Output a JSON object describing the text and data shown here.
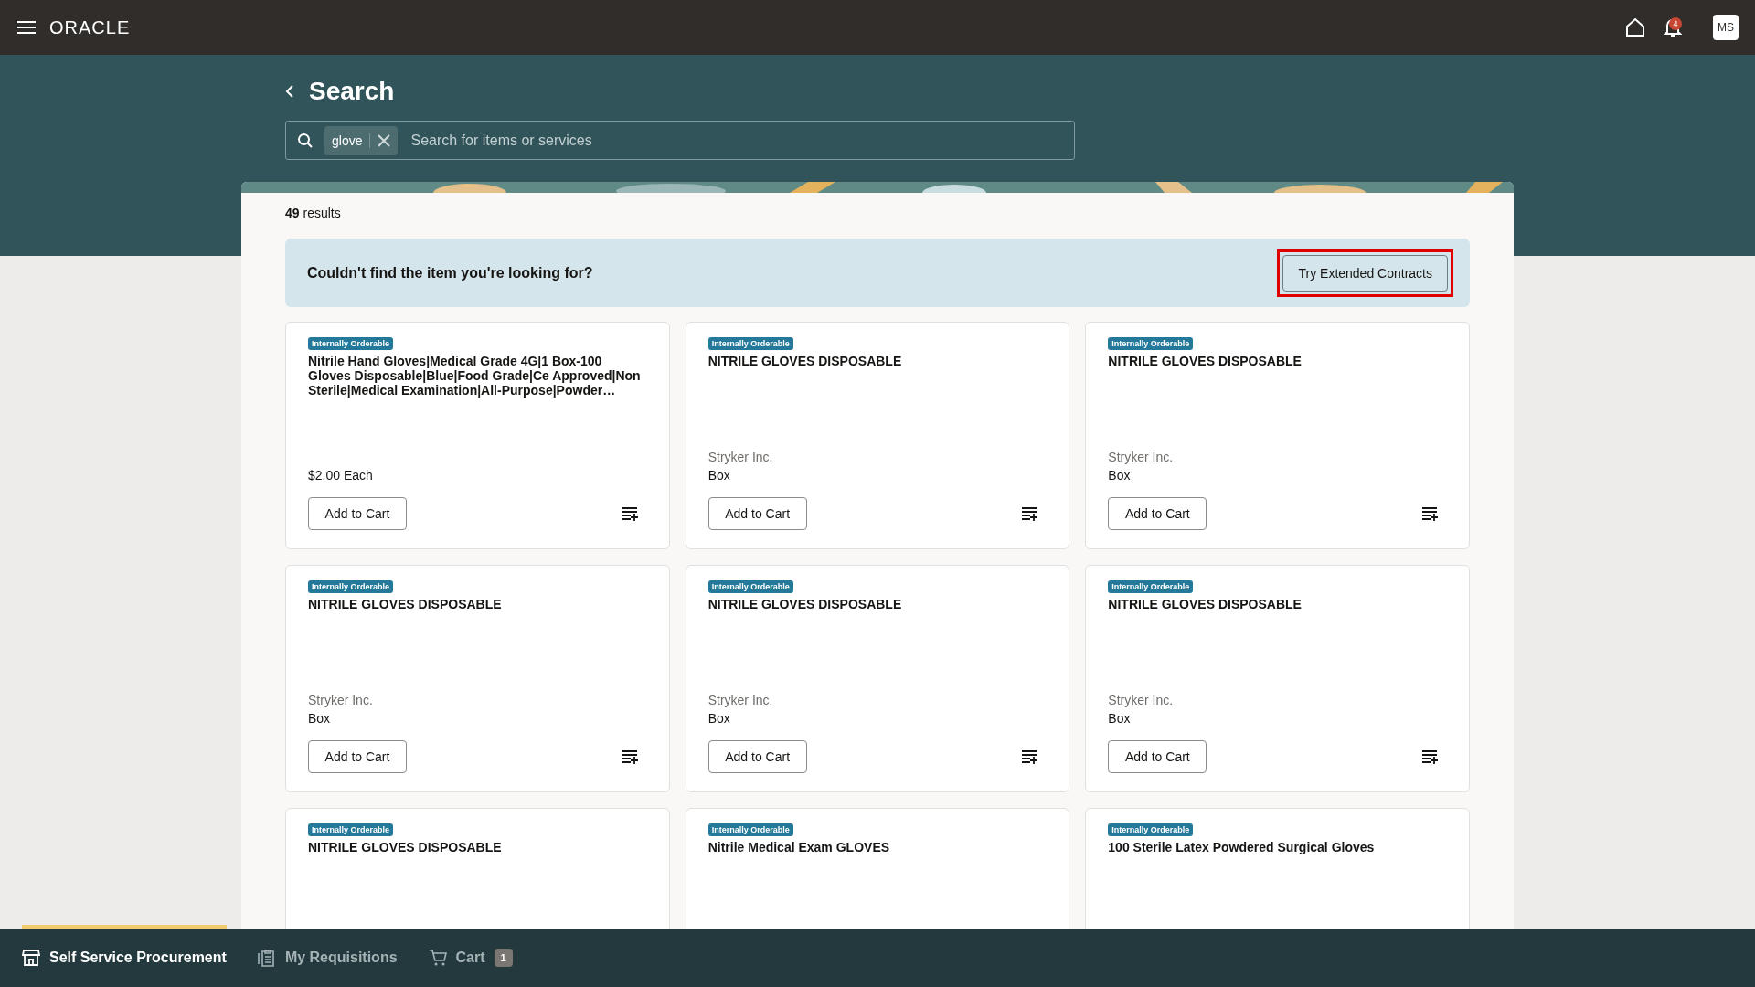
{
  "header": {
    "logo": "ORACLE",
    "notifications": "4",
    "avatar": "MS"
  },
  "page": {
    "title": "Search",
    "search": {
      "chip": "glove",
      "placeholder": "Search for items or services"
    }
  },
  "results": {
    "count": "49",
    "label": "results"
  },
  "banner": {
    "text": "Couldn't find the item you're looking for?",
    "button": {
      "label": "Try Extended Contracts",
      "highlighted": true
    }
  },
  "cards": [
    {
      "badge": "Internally Orderable",
      "title": "Nitrile Hand Gloves|Medical Grade 4G|1 Box-100 Gloves Disposable|Blue|Food Grade|Ce Approved|Non Sterile|Medical Examination|All-Purpose|Powder…",
      "price": "$2.00 Each",
      "button": "Add to Cart"
    },
    {
      "badge": "Internally Orderable",
      "title": "NITRILE GLOVES DISPOSABLE",
      "supplier": "Stryker Inc.",
      "uom": "Box",
      "button": "Add to Cart"
    },
    {
      "badge": "Internally Orderable",
      "title": "NITRILE GLOVES DISPOSABLE",
      "supplier": "Stryker Inc.",
      "uom": "Box",
      "button": "Add to Cart"
    },
    {
      "badge": "Internally Orderable",
      "title": "NITRILE GLOVES DISPOSABLE",
      "supplier": "Stryker Inc.",
      "uom": "Box",
      "button": "Add to Cart"
    },
    {
      "badge": "Internally Orderable",
      "title": "NITRILE GLOVES DISPOSABLE",
      "supplier": "Stryker Inc.",
      "uom": "Box",
      "button": "Add to Cart"
    },
    {
      "badge": "Internally Orderable",
      "title": "NITRILE GLOVES DISPOSABLE",
      "supplier": "Stryker Inc.",
      "uom": "Box",
      "button": "Add to Cart"
    },
    {
      "badge": "Internally Orderable",
      "title": "NITRILE GLOVES DISPOSABLE"
    },
    {
      "badge": "Internally Orderable",
      "title": "Nitrile Medical Exam GLOVES"
    },
    {
      "badge": "Internally Orderable",
      "title": "100 Sterile Latex Powdered Surgical Gloves"
    }
  ],
  "bottom_nav": [
    {
      "kind": "store",
      "label": "Self Service Procurement",
      "selected": true
    },
    {
      "kind": "clipboard",
      "label": "My Requisitions",
      "selected": false
    },
    {
      "kind": "cart",
      "label": "Cart",
      "count": "1",
      "selected": false
    }
  ]
}
